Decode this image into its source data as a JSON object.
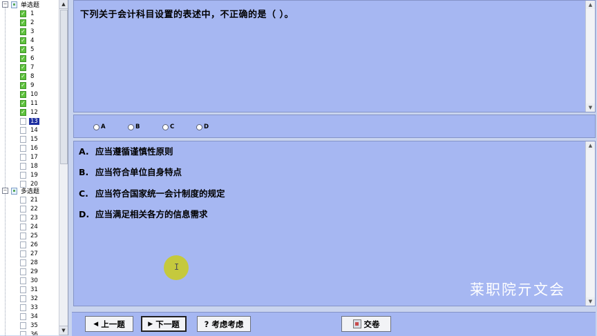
{
  "tree": {
    "single_group": {
      "label": "单选题",
      "collapse": "−"
    },
    "multi_group": {
      "label": "多选题",
      "collapse": "−"
    },
    "single_items": [
      {
        "num": "1",
        "done": true
      },
      {
        "num": "2",
        "done": true
      },
      {
        "num": "3",
        "done": true
      },
      {
        "num": "4",
        "done": true
      },
      {
        "num": "5",
        "done": true
      },
      {
        "num": "6",
        "done": true
      },
      {
        "num": "7",
        "done": true
      },
      {
        "num": "8",
        "done": true
      },
      {
        "num": "9",
        "done": true
      },
      {
        "num": "10",
        "done": true
      },
      {
        "num": "11",
        "done": true
      },
      {
        "num": "12",
        "done": true
      },
      {
        "num": "13",
        "done": false,
        "current": true
      },
      {
        "num": "14",
        "done": false
      },
      {
        "num": "15",
        "done": false
      },
      {
        "num": "16",
        "done": false
      },
      {
        "num": "17",
        "done": false
      },
      {
        "num": "18",
        "done": false
      },
      {
        "num": "19",
        "done": false
      },
      {
        "num": "20",
        "done": false
      }
    ],
    "multi_items": [
      "21",
      "22",
      "23",
      "24",
      "25",
      "26",
      "27",
      "28",
      "29",
      "30",
      "31",
      "32",
      "33",
      "34",
      "35",
      "36"
    ]
  },
  "question": {
    "text": "下列关于会计科目设置的表述中，不正确的是（ ）。"
  },
  "options": [
    "A",
    "B",
    "C",
    "D"
  ],
  "answers": [
    {
      "letter": "A.",
      "text": "应当遵循谨慎性原则"
    },
    {
      "letter": "B.",
      "text": "应当符合单位自身特点"
    },
    {
      "letter": "C.",
      "text": "应当符合国家统一会计制度的规定"
    },
    {
      "letter": "D.",
      "text": "应当满足相关各方的信息需求"
    }
  ],
  "watermark": "莱职院亓文会",
  "cursor_glyph": "I",
  "buttons": {
    "prev": {
      "label": "上一题",
      "icon": "◀"
    },
    "next": {
      "label": "下一题",
      "icon": "▶"
    },
    "consider": {
      "label": "考虑考虑",
      "icon": "?"
    },
    "submit": {
      "label": "交卷"
    }
  },
  "colors": {
    "panel": "#a6b7f2",
    "done_check": "#5ec33c",
    "current_highlight": "#1d2ea0",
    "cursor_highlight": "#c9cc2a"
  }
}
